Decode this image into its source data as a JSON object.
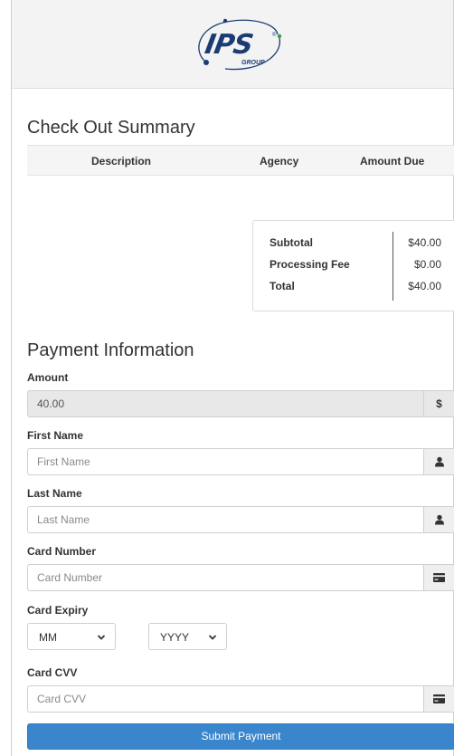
{
  "header": {
    "logo_text": "IPS",
    "logo_sub": "GROUP",
    "logo_reg": "®"
  },
  "checkout": {
    "title": "Check Out Summary",
    "columns": [
      "Description",
      "Agency",
      "Amount Due"
    ]
  },
  "summary": {
    "rows": [
      {
        "label": "Subtotal",
        "value": "$40.00"
      },
      {
        "label": "Processing Fee",
        "value": "$0.00"
      },
      {
        "label": "Total",
        "value": "$40.00"
      }
    ]
  },
  "payment": {
    "title": "Payment Information",
    "amount": {
      "label": "Amount",
      "value": "40.00",
      "addon": "$"
    },
    "first_name": {
      "label": "First Name",
      "placeholder": "First Name"
    },
    "last_name": {
      "label": "Last Name",
      "placeholder": "Last Name"
    },
    "card_number": {
      "label": "Card Number",
      "placeholder": "Card Number"
    },
    "card_expiry": {
      "label": "Card Expiry",
      "month": "MM",
      "year": "YYYY"
    },
    "card_cvv": {
      "label": "Card CVV",
      "placeholder": "Card CVV"
    },
    "submit_label": "Submit Payment"
  },
  "colors": {
    "accent": "#3a86cd",
    "brand": "#1b3c73"
  }
}
